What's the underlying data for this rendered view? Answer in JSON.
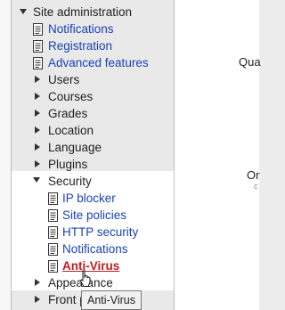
{
  "nav": {
    "site_admin": "Site administration",
    "notifications": "Notifications",
    "registration": "Registration",
    "advanced_features": "Advanced features",
    "users": "Users",
    "courses": "Courses",
    "grades": "Grades",
    "location": "Location",
    "language": "Language",
    "plugins": "Plugins",
    "security": {
      "label": "Security",
      "items": {
        "ip_blocker": "IP blocker",
        "site_policies": "Site policies",
        "http_security": "HTTP security",
        "notifications": "Notifications",
        "antivirus": "Anti-Virus"
      }
    },
    "appearance": "Appearance",
    "front_page": "Front page"
  },
  "right": {
    "frag1": "Qua",
    "frag2": "Or"
  },
  "tooltip": "Anti-Virus",
  "colors": {
    "link": "#1a42b8",
    "active_link": "#c11b1b",
    "panel_bg": "#e9e9e9"
  }
}
